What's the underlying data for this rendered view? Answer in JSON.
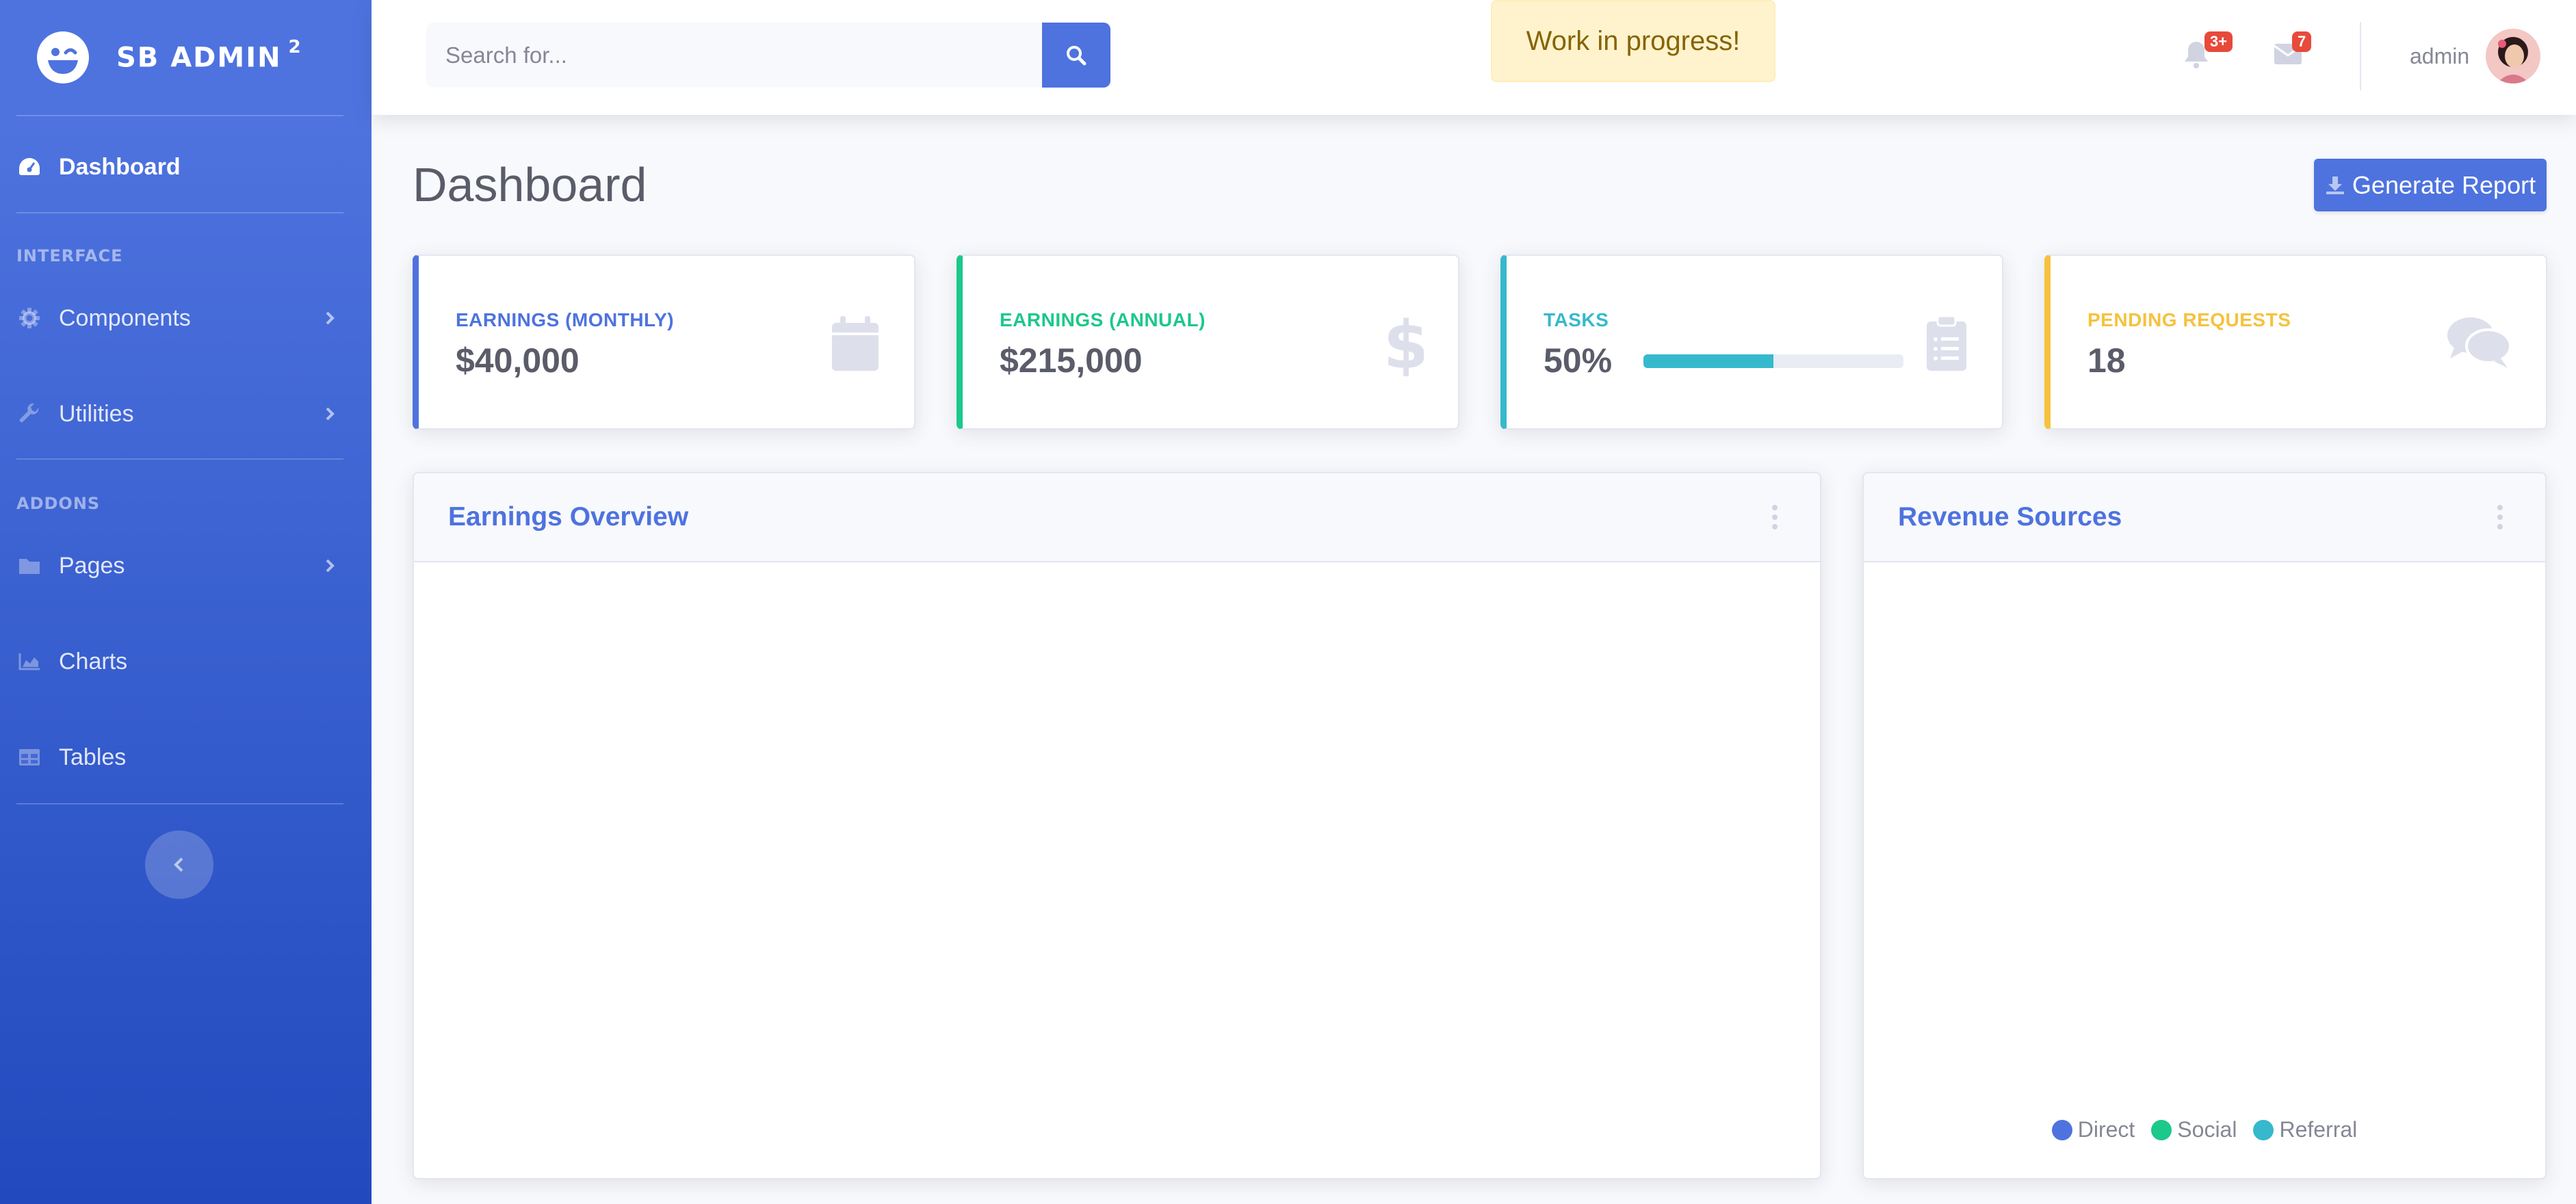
{
  "brand": {
    "name": "SB ADMIN",
    "superscript": "2"
  },
  "sidebar": {
    "headings": {
      "interface": "INTERFACE",
      "addons": "ADDONS"
    },
    "items": [
      {
        "label": "Dashboard",
        "icon": "tachometer-icon",
        "active": true
      },
      {
        "label": "Components",
        "icon": "gear-icon"
      },
      {
        "label": "Utilities",
        "icon": "wrench-icon"
      },
      {
        "label": "Pages",
        "icon": "folder-icon"
      },
      {
        "label": "Charts",
        "icon": "area-chart-icon"
      },
      {
        "label": "Tables",
        "icon": "table-icon"
      }
    ]
  },
  "topbar": {
    "search_placeholder": "Search for...",
    "alert": "Work in progress!",
    "notifications_badge": "3+",
    "messages_badge": "7",
    "user": "admin"
  },
  "main": {
    "title": "Dashboard",
    "report_button": "Generate Report",
    "stats": [
      {
        "label": "EARNINGS (MONTHLY)",
        "value": "$40,000",
        "color": "#4e73df",
        "icon": "calendar-icon"
      },
      {
        "label": "EARNINGS (ANNUAL)",
        "value": "$215,000",
        "color": "#1cc88a",
        "icon": "dollar-icon"
      },
      {
        "label": "TASKS",
        "value": "50%",
        "color": "#36b9cc",
        "icon": "clipboard-list-icon",
        "progress": 0.5
      },
      {
        "label": "PENDING REQUESTS",
        "value": "18",
        "color": "#f6c23e",
        "icon": "comments-icon"
      }
    ],
    "earnings_card": {
      "title": "Earnings Overview"
    },
    "revenue_card": {
      "title": "Revenue Sources",
      "legend": [
        {
          "label": "Direct",
          "color": "#4e73df"
        },
        {
          "label": "Social",
          "color": "#1cc88a"
        },
        {
          "label": "Referral",
          "color": "#36b9cc"
        }
      ]
    }
  }
}
